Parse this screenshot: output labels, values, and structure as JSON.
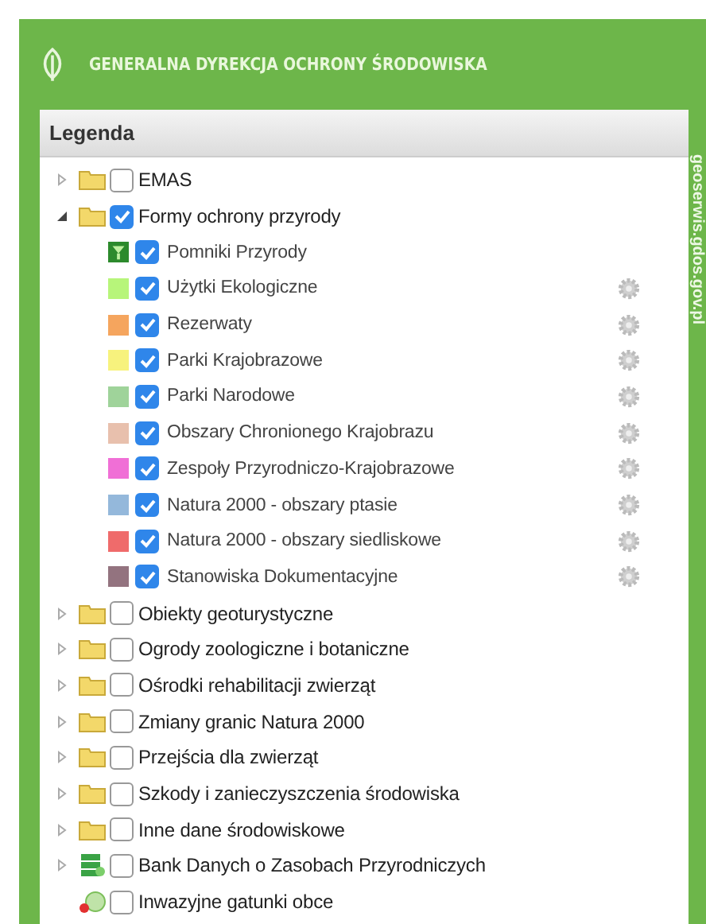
{
  "header": {
    "title": "GENERALNA DYREKCJA OCHRONY ŚRODOWISKA"
  },
  "side_label": "geoserwis.gdos.gov.pl",
  "legend": {
    "title": "Legenda",
    "items": [
      {
        "label": "EMAS",
        "kind": "folder",
        "expanded": false,
        "checked": false
      },
      {
        "label": "Formy ochrony przyrody",
        "kind": "folder",
        "expanded": true,
        "checked": true,
        "children": [
          {
            "label": "Pomniki Przyrody",
            "kind": "tree",
            "checked": true,
            "settings": false
          },
          {
            "label": "Użytki Ekologiczne",
            "kind": "swatch",
            "color": "#b7f57a",
            "checked": true,
            "settings": true
          },
          {
            "label": "Rezerwaty",
            "kind": "swatch",
            "color": "#f5a55e",
            "checked": true,
            "settings": true
          },
          {
            "label": "Parki Krajobrazowe",
            "kind": "swatch",
            "color": "#f7f27d",
            "checked": true,
            "settings": true
          },
          {
            "label": "Parki Narodowe",
            "kind": "swatch",
            "color": "#9fd39a",
            "checked": true,
            "settings": true
          },
          {
            "label": "Obszary Chronionego Krajobrazu",
            "kind": "swatch",
            "color": "#e8c0ad",
            "checked": true,
            "settings": true
          },
          {
            "label": "Zespoły Przyrodniczo-Krajobrazowe",
            "kind": "swatch",
            "color": "#f06fd6",
            "checked": true,
            "settings": true
          },
          {
            "label": "Natura 2000 - obszary ptasie",
            "kind": "swatch",
            "color": "#94b8db",
            "checked": true,
            "settings": true
          },
          {
            "label": "Natura 2000 - obszary siedliskowe",
            "kind": "swatch",
            "color": "#ef6b6b",
            "checked": true,
            "settings": true
          },
          {
            "label": "Stanowiska Dokumentacyjne",
            "kind": "swatch",
            "color": "#93737f",
            "checked": true,
            "settings": true
          }
        ]
      },
      {
        "label": "Obiekty geoturystyczne",
        "kind": "folder",
        "expanded": false,
        "checked": false
      },
      {
        "label": "Ogrody zoologiczne i botaniczne",
        "kind": "folder",
        "expanded": false,
        "checked": false
      },
      {
        "label": "Ośrodki rehabilitacji zwierząt",
        "kind": "folder",
        "expanded": false,
        "checked": false
      },
      {
        "label": "Zmiany granic Natura 2000",
        "kind": "folder",
        "expanded": false,
        "checked": false
      },
      {
        "label": "Przejścia dla zwierząt",
        "kind": "folder",
        "expanded": false,
        "checked": false
      },
      {
        "label": "Szkody i zanieczyszczenia środowiska",
        "kind": "folder",
        "expanded": false,
        "checked": false
      },
      {
        "label": "Inne dane środowiskowe",
        "kind": "folder",
        "expanded": false,
        "checked": false
      },
      {
        "label": "Bank Danych o Zasobach Przyrodniczych",
        "kind": "database",
        "expanded": false,
        "checked": false
      },
      {
        "label": "Inwazyjne gatunki obce",
        "kind": "invasive",
        "checked": false
      }
    ]
  }
}
